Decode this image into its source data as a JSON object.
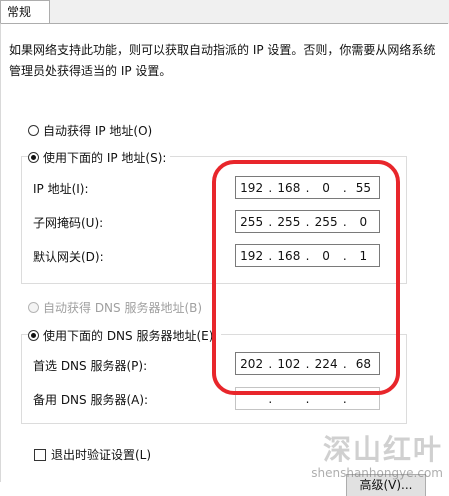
{
  "tab": {
    "label": "常规"
  },
  "description": "如果网络支持此功能，则可以获取自动指派的 IP 设置。否则，你需要从网络系统管理员处获得适当的 IP 设置。",
  "ip_mode": {
    "auto_label": "自动获得 IP 地址(O)",
    "manual_label": "使用下面的 IP 地址(S):",
    "selected": "manual"
  },
  "ip_settings": {
    "ip_label": "IP 地址(I):",
    "ip": [
      "192",
      "168",
      "0",
      "55"
    ],
    "mask_label": "子网掩码(U):",
    "mask": [
      "255",
      "255",
      "255",
      "0"
    ],
    "gateway_label": "默认网关(D):",
    "gateway": [
      "192",
      "168",
      "0",
      "1"
    ]
  },
  "dns_mode": {
    "auto_label": "自动获得 DNS 服务器地址(B)",
    "manual_label": "使用下面的 DNS 服务器地址(E):",
    "selected": "manual",
    "auto_enabled": false
  },
  "dns_settings": {
    "preferred_label": "首选 DNS 服务器(P):",
    "preferred": [
      "202",
      "102",
      "224",
      "68"
    ],
    "alternate_label": "备用 DNS 服务器(A):",
    "alternate": [
      "",
      "",
      "",
      ""
    ]
  },
  "validate": {
    "label": "退出时验证设置(L)",
    "checked": false
  },
  "advanced_button": {
    "label": "高级(V)..."
  },
  "colors": {
    "highlight": "#e8262b",
    "border": "#adadad"
  },
  "watermark": {
    "cn": "深山红叶",
    "en": "shenshanhongye.com"
  }
}
